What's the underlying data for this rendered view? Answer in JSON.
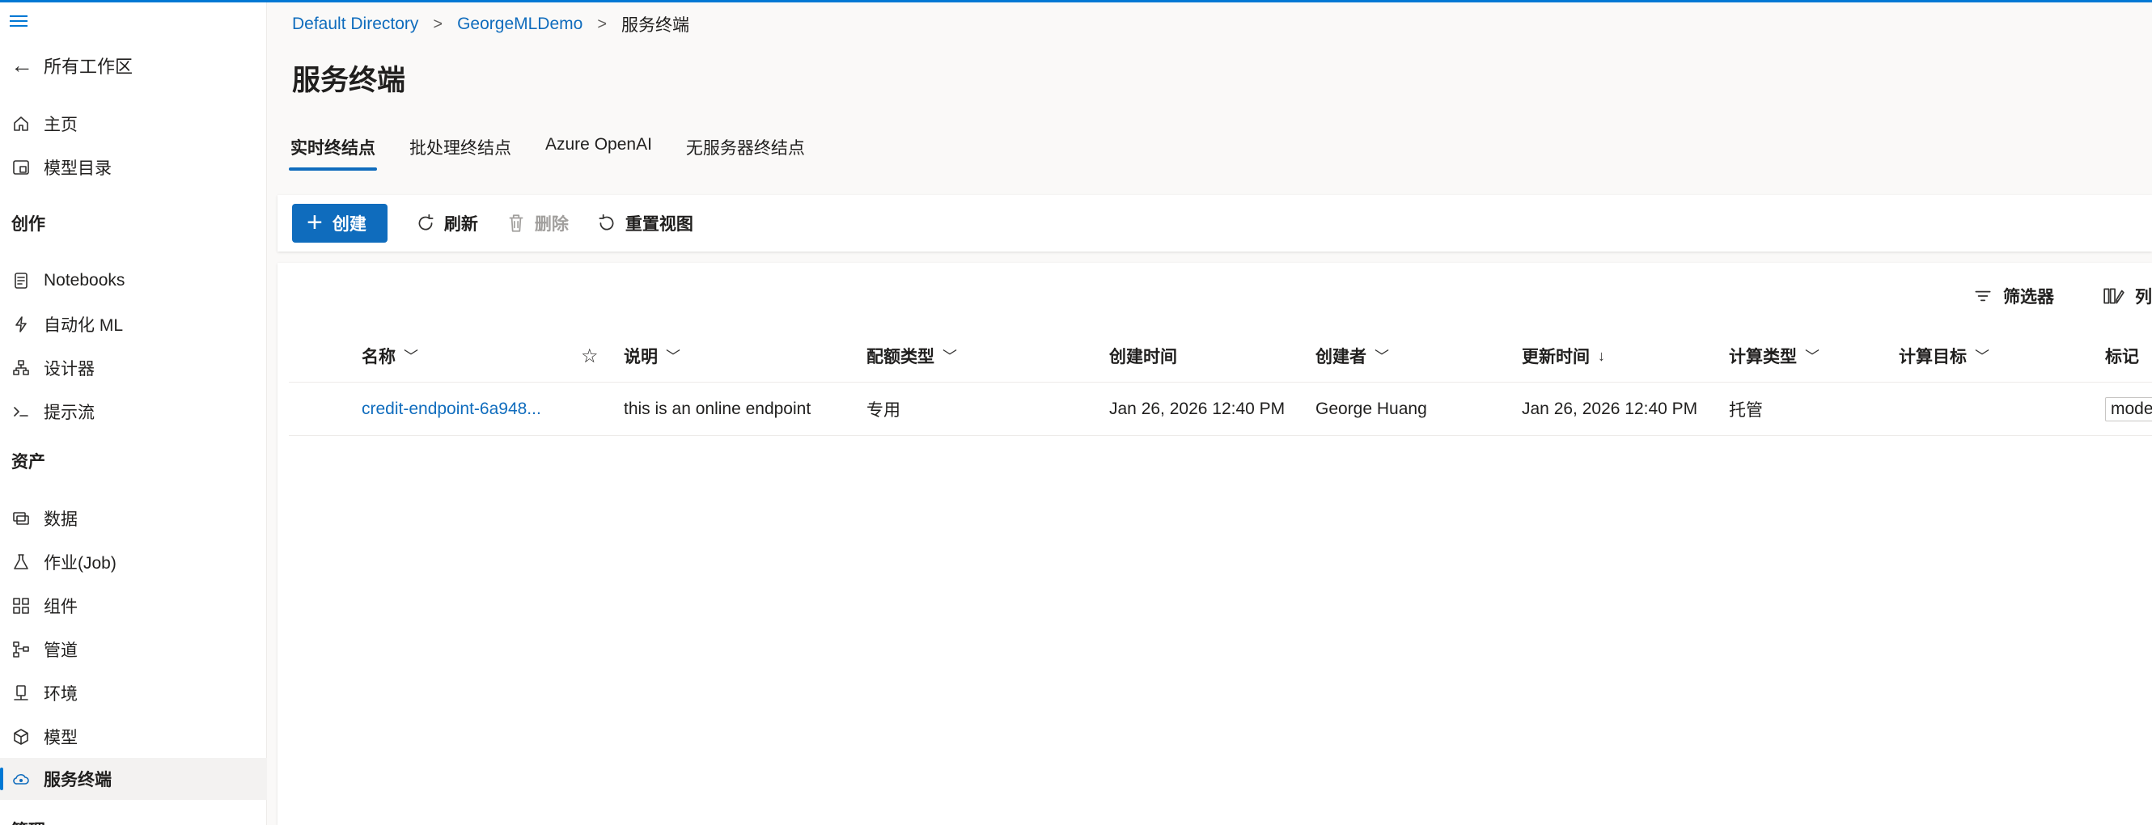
{
  "breadcrumb": {
    "directory": "Default Directory",
    "workspace": "GeorgeMLDemo",
    "current": "服务终端"
  },
  "sidebar": {
    "back_label": "所有工作区",
    "home": "主页",
    "model_catalog": "模型目录",
    "section_authoring": "创作",
    "notebooks": "Notebooks",
    "automl": "自动化 ML",
    "designer": "设计器",
    "prompt_flow": "提示流",
    "section_assets": "资产",
    "data": "数据",
    "jobs": "作业(Job)",
    "components": "组件",
    "pipelines": "管道",
    "environments": "环境",
    "models": "模型",
    "endpoints": "服务终端",
    "section_manage": "管理"
  },
  "page": {
    "title": "服务终端"
  },
  "tabs": [
    "实时终结点",
    "批处理终结点",
    "Azure OpenAI",
    "无服务器终结点"
  ],
  "toolbar": {
    "create": "创建",
    "refresh": "刷新",
    "delete": "删除",
    "reset_view": "重置视图"
  },
  "panel": {
    "filters": "筛选器",
    "columns": "列"
  },
  "table": {
    "headers": {
      "name": "名称",
      "description": "说明",
      "quota_type": "配额类型",
      "created_on": "创建时间",
      "created_by": "创建者",
      "updated_on": "更新时间",
      "compute_type": "计算类型",
      "compute_target": "计算目标",
      "tags": "标记"
    },
    "rows": [
      {
        "name": "credit-endpoint-6a948...",
        "description": "this is an online endpoint",
        "quota_type": "专用",
        "created_on": "Jan 26, 2026 12:40 PM",
        "created_by": "George Huang",
        "updated_on": "Jan 26, 2026 12:40 PM",
        "compute_type": "托管",
        "compute_target": "",
        "tags": "mode"
      }
    ]
  },
  "colors": {
    "accent": "#0f6cbd",
    "brand_bar": "#0078d4"
  }
}
